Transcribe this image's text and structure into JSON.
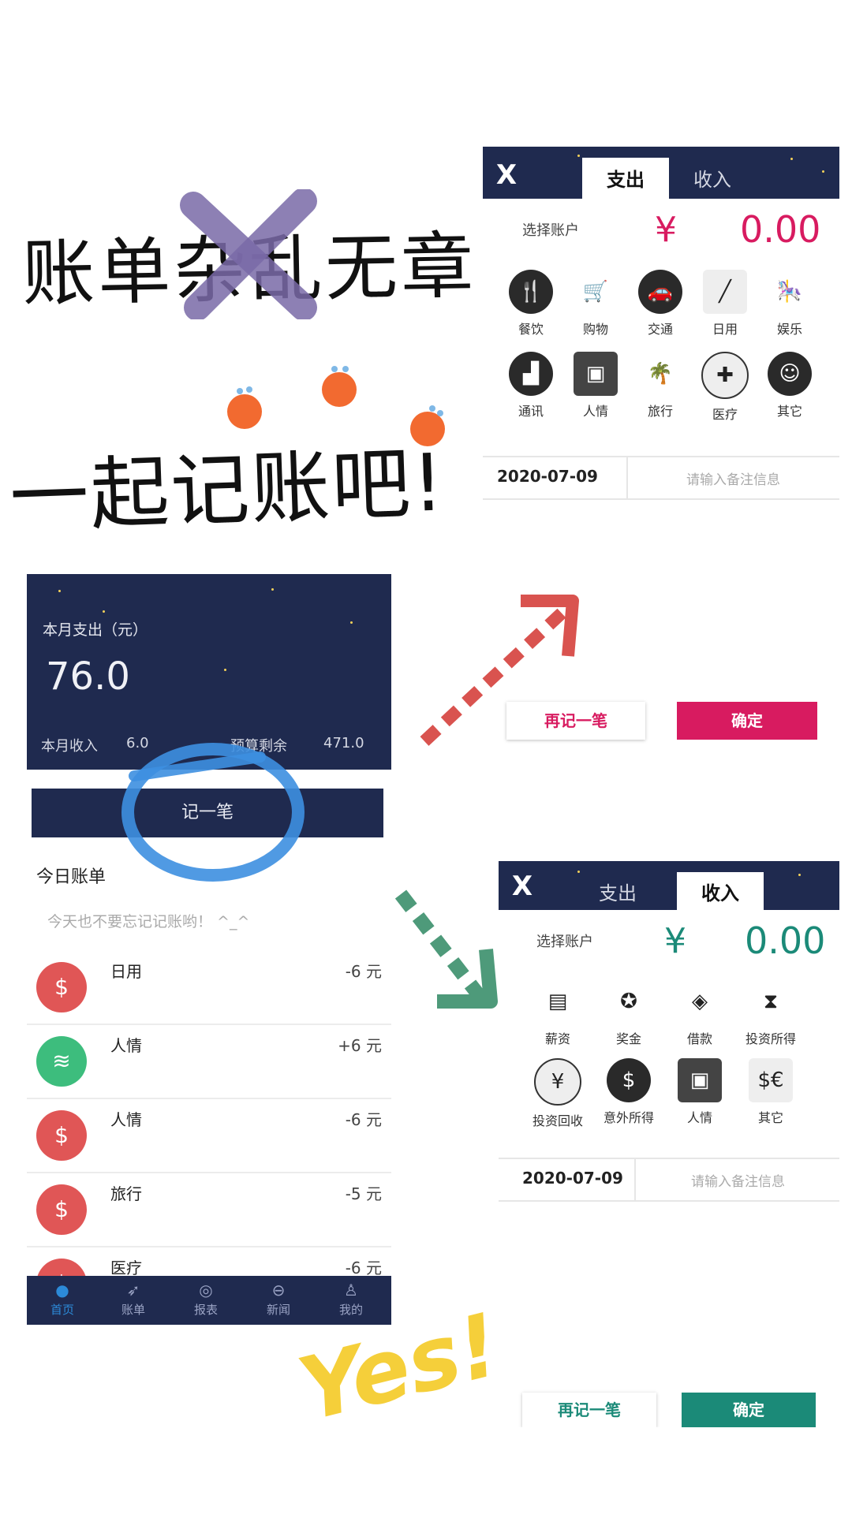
{
  "headline": {
    "line1": "账单杂乱无章",
    "line2": "一起记账吧!",
    "yes": "Yes!"
  },
  "colors": {
    "navy": "#1f2a4f",
    "expense_accent": "#d81b60",
    "income_accent": "#1b8a78",
    "red_arrow": "#d9534f",
    "green_arrow": "#4e9a7a",
    "blue_circle": "#3d8fe0",
    "yes_yellow": "#f5cf3a",
    "purple_cross": "#7a6aa8"
  },
  "home": {
    "month_expense_label": "本月支出（元）",
    "month_expense_value": "76.0",
    "month_income_label": "本月收入",
    "month_income_value": "6.0",
    "budget_label": "预算剩余",
    "budget_value": "471.0",
    "record_button": "记一笔",
    "today_title": "今日账单",
    "today_hint": "今天也不要忘记记账哟！ ^_^",
    "items": [
      {
        "name": "日用",
        "amount": "-6 元",
        "icon": "money-bag-icon"
      },
      {
        "name": "人情",
        "amount": "+6 元",
        "icon": "coins-stack-icon"
      },
      {
        "name": "人情",
        "amount": "-6 元",
        "icon": "money-bag-icon"
      },
      {
        "name": "旅行",
        "amount": "-5 元",
        "icon": "money-bag-icon"
      },
      {
        "name": "医疗",
        "amount": "-6 元",
        "icon": "money-bag-icon"
      }
    ],
    "nav": [
      {
        "label": "首页",
        "icon": "planet-icon"
      },
      {
        "label": "账单",
        "icon": "rocket-icon"
      },
      {
        "label": "报表",
        "icon": "orbit-icon"
      },
      {
        "label": "新闻",
        "icon": "saturn-icon"
      },
      {
        "label": "我的",
        "icon": "astronaut-icon"
      }
    ]
  },
  "expense": {
    "close": "X",
    "tab_expense": "支出",
    "tab_income": "收入",
    "account_label": "选择账户",
    "currency": "¥",
    "amount": "0.00",
    "categories": [
      {
        "label": "餐饮",
        "icon": "dining-icon"
      },
      {
        "label": "购物",
        "icon": "cart-icon"
      },
      {
        "label": "交通",
        "icon": "car-icon"
      },
      {
        "label": "日用",
        "icon": "toothbrush-icon"
      },
      {
        "label": "娱乐",
        "icon": "bumper-car-icon"
      },
      {
        "label": "通讯",
        "icon": "chart-icon"
      },
      {
        "label": "人情",
        "icon": "gift-icon"
      },
      {
        "label": "旅行",
        "icon": "palm-tree-icon"
      },
      {
        "label": "医疗",
        "icon": "medical-cross-icon"
      },
      {
        "label": "其它",
        "icon": "other-icon"
      }
    ],
    "date": "2020-07-09",
    "note_placeholder": "请输入备注信息",
    "again_button": "再记一笔",
    "confirm_button": "确定"
  },
  "income": {
    "close": "X",
    "tab_expense": "支出",
    "tab_income": "收入",
    "account_label": "选择账户",
    "currency": "¥",
    "amount": "0.00",
    "categories": [
      {
        "label": "薪资",
        "icon": "card-icon"
      },
      {
        "label": "奖金",
        "icon": "medal-icon"
      },
      {
        "label": "借款",
        "icon": "cash-icon"
      },
      {
        "label": "投资所得",
        "icon": "investment-icon"
      },
      {
        "label": "投资回收",
        "icon": "yen-cycle-icon"
      },
      {
        "label": "意外所得",
        "icon": "money-bag-icon"
      },
      {
        "label": "人情",
        "icon": "gift-icon"
      },
      {
        "label": "其它",
        "icon": "currency-coins-icon"
      }
    ],
    "date": "2020-07-09",
    "note_placeholder": "请输入备注信息",
    "again_button": "再记一笔",
    "confirm_button": "确定"
  }
}
